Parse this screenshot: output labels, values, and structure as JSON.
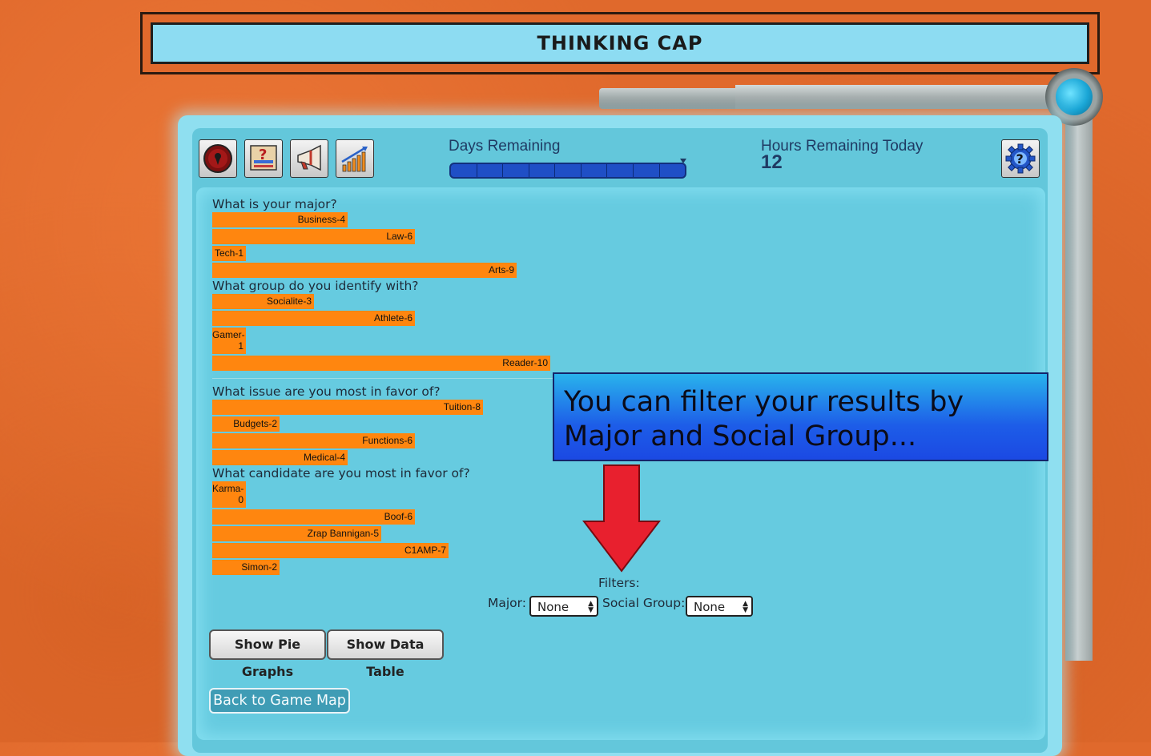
{
  "header": {
    "title": "THINKING CAP"
  },
  "toolbar": {
    "icons": [
      "map-pin-icon",
      "help-card-icon",
      "megaphone-icon",
      "growth-chart-icon"
    ],
    "settings_icon": "gear-question-icon"
  },
  "status": {
    "days_label": "Days Remaining",
    "days_segments": 9,
    "hours_label": "Hours Remaining Today",
    "hours_value": "12"
  },
  "chart_data": {
    "type": "bar",
    "questions": [
      {
        "question": "What is your major?",
        "categories": [
          "Business",
          "Law",
          "Tech",
          "Arts"
        ],
        "values": [
          4,
          6,
          1,
          9
        ],
        "labels": [
          "Business-4",
          "Law-6",
          "Tech-1",
          "Arts-9"
        ]
      },
      {
        "question": "What group do you identify with?",
        "categories": [
          "Socialite",
          "Athlete",
          "Gamer",
          "Reader"
        ],
        "values": [
          3,
          6,
          1,
          10
        ],
        "labels": [
          "Socialite-3",
          "Athlete-6",
          "Gamer-1",
          "Reader-10"
        ]
      },
      {
        "question": "What issue are you most in favor of?",
        "categories": [
          "Tuition",
          "Budgets",
          "Functions",
          "Medical"
        ],
        "values": [
          8,
          2,
          6,
          4
        ],
        "labels": [
          "Tuition-8",
          "Budgets-2",
          "Functions-6",
          "Medical-4"
        ]
      },
      {
        "question": "What candidate are you most in favor of?",
        "categories": [
          "Karma",
          "Boof",
          "Zrap Bannigan",
          "C1AMP",
          "Simon"
        ],
        "values": [
          0,
          6,
          5,
          7,
          2
        ],
        "labels": [
          "Karma-0",
          "Boof-6",
          "Zrap Bannigan-5",
          "C1AMP-7",
          "Simon-2"
        ]
      }
    ],
    "bar_color": "#ff860f"
  },
  "callout": {
    "text": "You can filter your results by Major and Social Group..."
  },
  "filters": {
    "label": "Filters:",
    "major_label": "Major:",
    "major_value": "None",
    "group_label": "Social Group:",
    "group_value": "None"
  },
  "buttons": {
    "pie": "Show Pie Graphs",
    "table": "Show Data Table",
    "back": "Back to Game Map"
  }
}
